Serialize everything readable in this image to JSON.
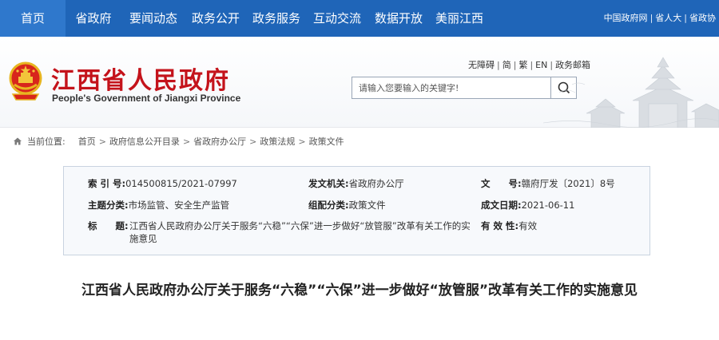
{
  "nav": {
    "items": [
      "首页",
      "省政府",
      "要闻动态",
      "政务公开",
      "政务服务",
      "互动交流",
      "数据开放",
      "美丽江西"
    ],
    "active_index": 0,
    "right_links": [
      "中国政府网",
      "省人大",
      "省政协"
    ]
  },
  "header": {
    "title": "江西省人民政府",
    "subtitle": "People's Government of Jiangxi Province",
    "access_links": [
      "无障碍",
      "简",
      "繁",
      "EN",
      "政务邮箱"
    ],
    "search_placeholder": "请输入您要输入的关键字!"
  },
  "breadcrumb": {
    "label": "当前位置:",
    "items": [
      "首页",
      "政府信息公开目录",
      "省政府办公厅",
      "政策法规",
      "政策文件"
    ]
  },
  "info": {
    "index_no_key": "索 引 号:",
    "index_no": "014500815/2021-07997",
    "issuer_key": "发文机关:",
    "issuer": "省政府办公厅",
    "doc_no_key": "文　　号:",
    "doc_no": "赣府厅发〔2021〕8号",
    "topic_key": "主题分类:",
    "topic": "市场监管、安全生产监管",
    "category_key": "组配分类:",
    "category": "政策文件",
    "date_key": "成文日期:",
    "date": "2021-06-11",
    "title_key": "标　　题:",
    "title": "江西省人民政府办公厅关于服务“六稳”“六保”进一步做好“放管服”改革有关工作的实施意见",
    "validity_key": "有 效 性:",
    "validity": "有效"
  },
  "article": {
    "title": "江西省人民政府办公厅关于服务“六稳”“六保”进一步做好“放管服”改革有关工作的实施意见"
  },
  "colors": {
    "nav_bg": "#1f65b8",
    "title_red": "#c4131b",
    "box_border": "#c9d3e0"
  }
}
